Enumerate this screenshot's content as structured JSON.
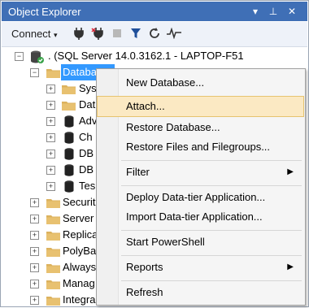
{
  "window": {
    "title": "Object Explorer",
    "buttons": [
      "▾",
      "⊥",
      "✕"
    ]
  },
  "toolbar": {
    "connect_label": "Connect"
  },
  "tree": {
    "server": ". (SQL Server 14.0.3162.1 - LAPTOP-F51",
    "databases": "Databases",
    "db_children": [
      "Sys",
      "Dat",
      "Adv",
      "Ch",
      "DB",
      "DB",
      "Tes"
    ],
    "server_children": [
      "Securit",
      "Server",
      "Replica",
      "PolyBa",
      "Always",
      "Manag",
      "Integra"
    ]
  },
  "context_menu": {
    "items": [
      {
        "label": "New Database..."
      },
      {
        "label": "Attach...",
        "highlighted": true
      },
      {
        "label": "Restore Database..."
      },
      {
        "label": "Restore Files and Filegroups..."
      },
      {
        "label": "Filter",
        "submenu": true
      },
      {
        "label": "Deploy Data-tier Application..."
      },
      {
        "label": "Import Data-tier Application..."
      },
      {
        "label": "Start PowerShell"
      },
      {
        "label": "Reports",
        "submenu": true
      },
      {
        "label": "Refresh"
      }
    ]
  },
  "colors": {
    "titlebar": "#3f6fb6",
    "selection": "#3399ff",
    "menu_highlight": "#fbe9c3"
  }
}
